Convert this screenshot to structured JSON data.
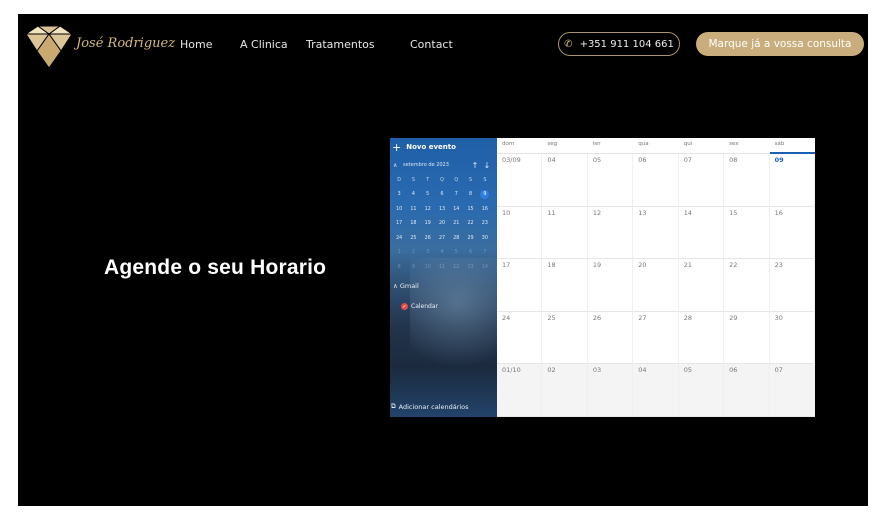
{
  "brand": {
    "name": "José Rodriguez"
  },
  "nav": {
    "items": [
      "Home",
      "A Clinica",
      "Tratamentos",
      "Contact"
    ]
  },
  "header": {
    "phone": "+351 911 104 661",
    "cta": "Marque já a vossa consulta"
  },
  "hero": {
    "title": "Agende o seu Horario"
  },
  "calendar": {
    "new_event": "Novo evento",
    "month_title": "setembro de 2023",
    "mini_dow": [
      "D",
      "S",
      "T",
      "Q",
      "Q",
      "S",
      "S"
    ],
    "mini_days": [
      "3",
      "4",
      "5",
      "6",
      "7",
      "8",
      "9",
      "10",
      "11",
      "12",
      "13",
      "14",
      "15",
      "16",
      "17",
      "18",
      "19",
      "20",
      "21",
      "22",
      "23",
      "24",
      "25",
      "26",
      "27",
      "28",
      "29",
      "30",
      "1",
      "2",
      "3",
      "4",
      "5",
      "6",
      "7",
      "8",
      "9",
      "10",
      "11",
      "12",
      "13",
      "14"
    ],
    "mini_today_index": 6,
    "mini_dim_from": 28,
    "group_label": "Gmail",
    "calendar_item": "Calendar",
    "add_calendars": "Adicionar calendários",
    "weekdays": [
      "dom",
      "seg",
      "ter",
      "qua",
      "qui",
      "sex",
      "sáb"
    ],
    "selected_weekday_index": 6,
    "weeks": [
      [
        "03/09",
        "04",
        "05",
        "06",
        "07",
        "08",
        "09"
      ],
      [
        "10",
        "11",
        "12",
        "13",
        "14",
        "15",
        "16"
      ],
      [
        "17",
        "18",
        "19",
        "20",
        "21",
        "22",
        "23"
      ],
      [
        "24",
        "25",
        "26",
        "27",
        "28",
        "29",
        "30"
      ],
      [
        "01/10",
        "02",
        "03",
        "04",
        "05",
        "06",
        "07"
      ]
    ],
    "today_cell": [
      0,
      6
    ]
  },
  "colors": {
    "gold": "#c9ad7c",
    "calendar_accent": "#1a5fb4",
    "calendar_today": "#2d7fe0"
  }
}
